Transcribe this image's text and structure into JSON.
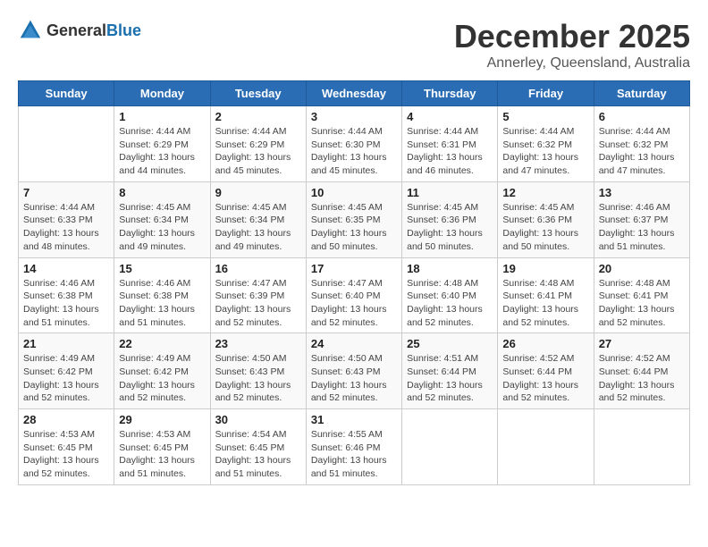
{
  "logo": {
    "general": "General",
    "blue": "Blue"
  },
  "header": {
    "month": "December 2025",
    "location": "Annerley, Queensland, Australia"
  },
  "weekdays": [
    "Sunday",
    "Monday",
    "Tuesday",
    "Wednesday",
    "Thursday",
    "Friday",
    "Saturday"
  ],
  "weeks": [
    [
      {
        "day": "",
        "info": ""
      },
      {
        "day": "1",
        "info": "Sunrise: 4:44 AM\nSunset: 6:29 PM\nDaylight: 13 hours\nand 44 minutes."
      },
      {
        "day": "2",
        "info": "Sunrise: 4:44 AM\nSunset: 6:29 PM\nDaylight: 13 hours\nand 45 minutes."
      },
      {
        "day": "3",
        "info": "Sunrise: 4:44 AM\nSunset: 6:30 PM\nDaylight: 13 hours\nand 45 minutes."
      },
      {
        "day": "4",
        "info": "Sunrise: 4:44 AM\nSunset: 6:31 PM\nDaylight: 13 hours\nand 46 minutes."
      },
      {
        "day": "5",
        "info": "Sunrise: 4:44 AM\nSunset: 6:32 PM\nDaylight: 13 hours\nand 47 minutes."
      },
      {
        "day": "6",
        "info": "Sunrise: 4:44 AM\nSunset: 6:32 PM\nDaylight: 13 hours\nand 47 minutes."
      }
    ],
    [
      {
        "day": "7",
        "info": "Sunrise: 4:44 AM\nSunset: 6:33 PM\nDaylight: 13 hours\nand 48 minutes."
      },
      {
        "day": "8",
        "info": "Sunrise: 4:45 AM\nSunset: 6:34 PM\nDaylight: 13 hours\nand 49 minutes."
      },
      {
        "day": "9",
        "info": "Sunrise: 4:45 AM\nSunset: 6:34 PM\nDaylight: 13 hours\nand 49 minutes."
      },
      {
        "day": "10",
        "info": "Sunrise: 4:45 AM\nSunset: 6:35 PM\nDaylight: 13 hours\nand 50 minutes."
      },
      {
        "day": "11",
        "info": "Sunrise: 4:45 AM\nSunset: 6:36 PM\nDaylight: 13 hours\nand 50 minutes."
      },
      {
        "day": "12",
        "info": "Sunrise: 4:45 AM\nSunset: 6:36 PM\nDaylight: 13 hours\nand 50 minutes."
      },
      {
        "day": "13",
        "info": "Sunrise: 4:46 AM\nSunset: 6:37 PM\nDaylight: 13 hours\nand 51 minutes."
      }
    ],
    [
      {
        "day": "14",
        "info": "Sunrise: 4:46 AM\nSunset: 6:38 PM\nDaylight: 13 hours\nand 51 minutes."
      },
      {
        "day": "15",
        "info": "Sunrise: 4:46 AM\nSunset: 6:38 PM\nDaylight: 13 hours\nand 51 minutes."
      },
      {
        "day": "16",
        "info": "Sunrise: 4:47 AM\nSunset: 6:39 PM\nDaylight: 13 hours\nand 52 minutes."
      },
      {
        "day": "17",
        "info": "Sunrise: 4:47 AM\nSunset: 6:40 PM\nDaylight: 13 hours\nand 52 minutes."
      },
      {
        "day": "18",
        "info": "Sunrise: 4:48 AM\nSunset: 6:40 PM\nDaylight: 13 hours\nand 52 minutes."
      },
      {
        "day": "19",
        "info": "Sunrise: 4:48 AM\nSunset: 6:41 PM\nDaylight: 13 hours\nand 52 minutes."
      },
      {
        "day": "20",
        "info": "Sunrise: 4:48 AM\nSunset: 6:41 PM\nDaylight: 13 hours\nand 52 minutes."
      }
    ],
    [
      {
        "day": "21",
        "info": "Sunrise: 4:49 AM\nSunset: 6:42 PM\nDaylight: 13 hours\nand 52 minutes."
      },
      {
        "day": "22",
        "info": "Sunrise: 4:49 AM\nSunset: 6:42 PM\nDaylight: 13 hours\nand 52 minutes."
      },
      {
        "day": "23",
        "info": "Sunrise: 4:50 AM\nSunset: 6:43 PM\nDaylight: 13 hours\nand 52 minutes."
      },
      {
        "day": "24",
        "info": "Sunrise: 4:50 AM\nSunset: 6:43 PM\nDaylight: 13 hours\nand 52 minutes."
      },
      {
        "day": "25",
        "info": "Sunrise: 4:51 AM\nSunset: 6:44 PM\nDaylight: 13 hours\nand 52 minutes."
      },
      {
        "day": "26",
        "info": "Sunrise: 4:52 AM\nSunset: 6:44 PM\nDaylight: 13 hours\nand 52 minutes."
      },
      {
        "day": "27",
        "info": "Sunrise: 4:52 AM\nSunset: 6:44 PM\nDaylight: 13 hours\nand 52 minutes."
      }
    ],
    [
      {
        "day": "28",
        "info": "Sunrise: 4:53 AM\nSunset: 6:45 PM\nDaylight: 13 hours\nand 52 minutes."
      },
      {
        "day": "29",
        "info": "Sunrise: 4:53 AM\nSunset: 6:45 PM\nDaylight: 13 hours\nand 51 minutes."
      },
      {
        "day": "30",
        "info": "Sunrise: 4:54 AM\nSunset: 6:45 PM\nDaylight: 13 hours\nand 51 minutes."
      },
      {
        "day": "31",
        "info": "Sunrise: 4:55 AM\nSunset: 6:46 PM\nDaylight: 13 hours\nand 51 minutes."
      },
      {
        "day": "",
        "info": ""
      },
      {
        "day": "",
        "info": ""
      },
      {
        "day": "",
        "info": ""
      }
    ]
  ]
}
